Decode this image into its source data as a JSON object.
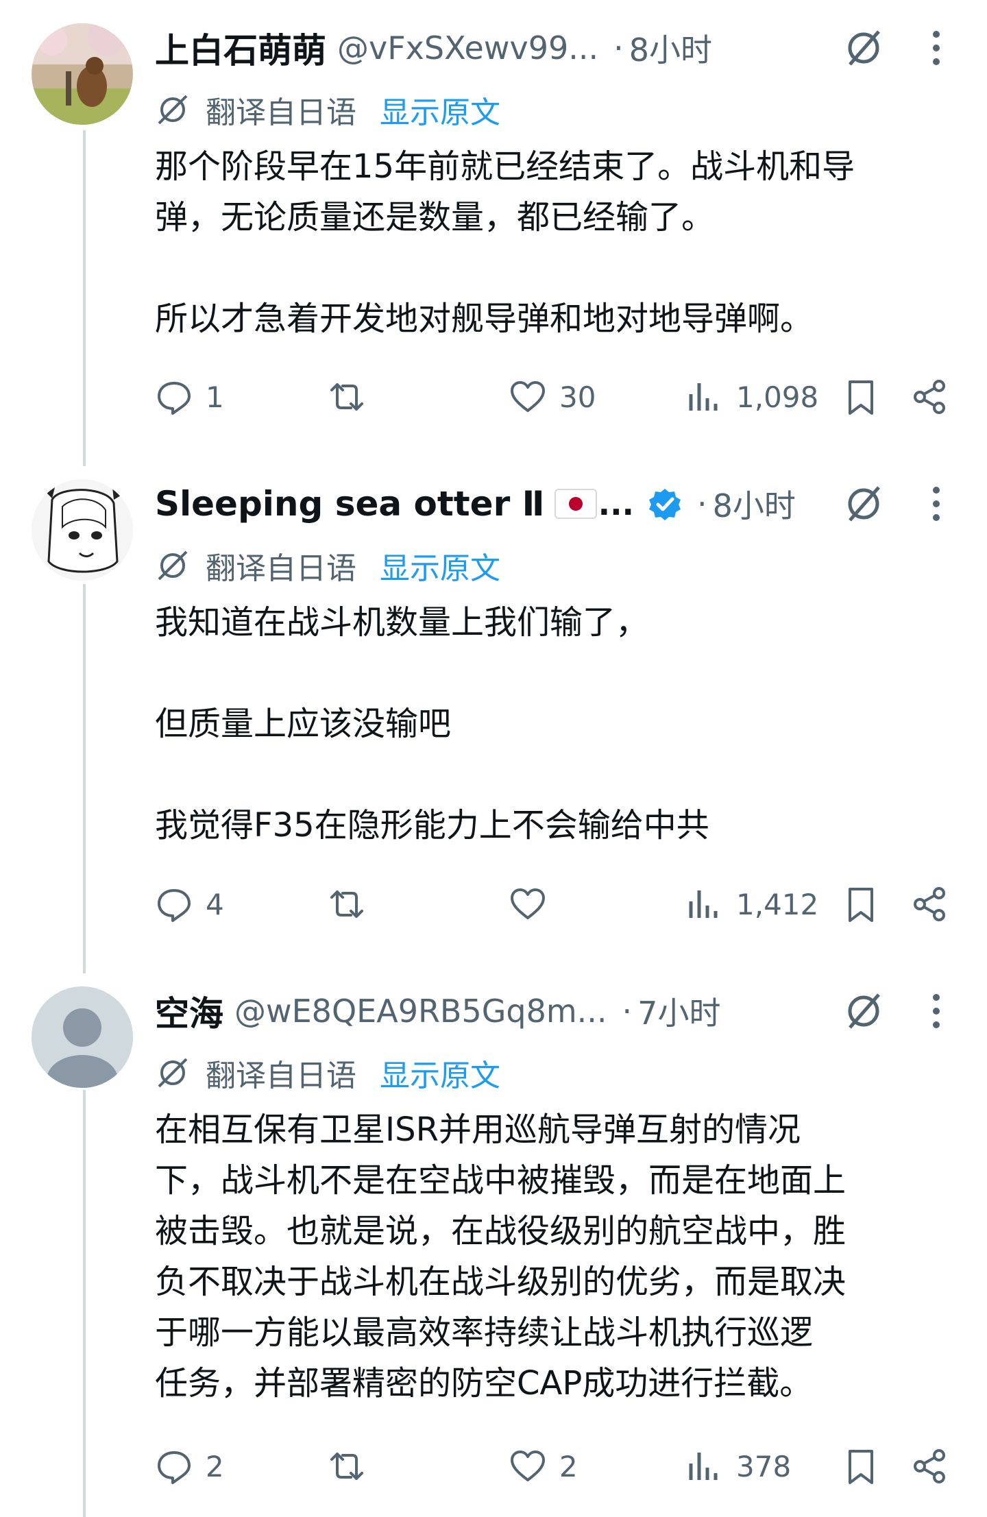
{
  "tweets": [
    {
      "name": "上白石萌萌",
      "handle": "@vFxSXewv99...",
      "dot": "·",
      "time": "8小时",
      "translate_label": "翻译自日语",
      "show_original": "显示原文",
      "body": [
        "那个阶段早在15年前就已经结束了。战斗机和导",
        "弹，无论质量还是数量，都已经输了。",
        "",
        "所以才急着开发地对舰导弹和地对地导弹啊。"
      ],
      "replies": "1",
      "retweets": "",
      "likes": "30",
      "views": "1,098"
    },
    {
      "name": "Sleeping sea otter Ⅱ",
      "ellipsis": "...",
      "verified": true,
      "dot": "·",
      "time": "8小时",
      "translate_label": "翻译自日语",
      "show_original": "显示原文",
      "body": [
        "我知道在战斗机数量上我们输了，",
        "",
        "但质量上应该没输吧",
        "",
        "我觉得F35在隐形能力上不会输给中共"
      ],
      "replies": "4",
      "retweets": "",
      "likes": "",
      "views": "1,412"
    },
    {
      "name": "空海",
      "handle": "@wE8QEA9RB5Gq8m...",
      "dot": "·",
      "time": "7小时",
      "translate_label": "翻译自日语",
      "show_original": "显示原文",
      "body": [
        "在相互保有卫星ISR并用巡航导弹互射的情况",
        "下，战斗机不是在空战中被摧毁，而是在地面上",
        "被击毁。也就是说，在战役级别的航空战中，胜",
        "负不取决于战斗机在战斗级别的优劣，而是取决",
        "于哪一方能以最高效率持续让战斗机执行巡逻",
        "任务，并部署精密的防空CAP成功进行拦截。"
      ],
      "replies": "2",
      "retweets": "",
      "likes": "2",
      "views": "378"
    }
  ],
  "colors": {
    "text": "#0f1419",
    "secondary": "#536471",
    "link": "#1d9bf0",
    "thread_line": "#cfd9de",
    "verified": "#1d9bf0"
  },
  "icons": [
    "grok-icon",
    "more-icon",
    "translate-icon",
    "reply-icon",
    "retweet-icon",
    "like-icon",
    "views-icon",
    "bookmark-icon",
    "share-icon",
    "verified-badge-icon",
    "japan-flag-icon"
  ]
}
